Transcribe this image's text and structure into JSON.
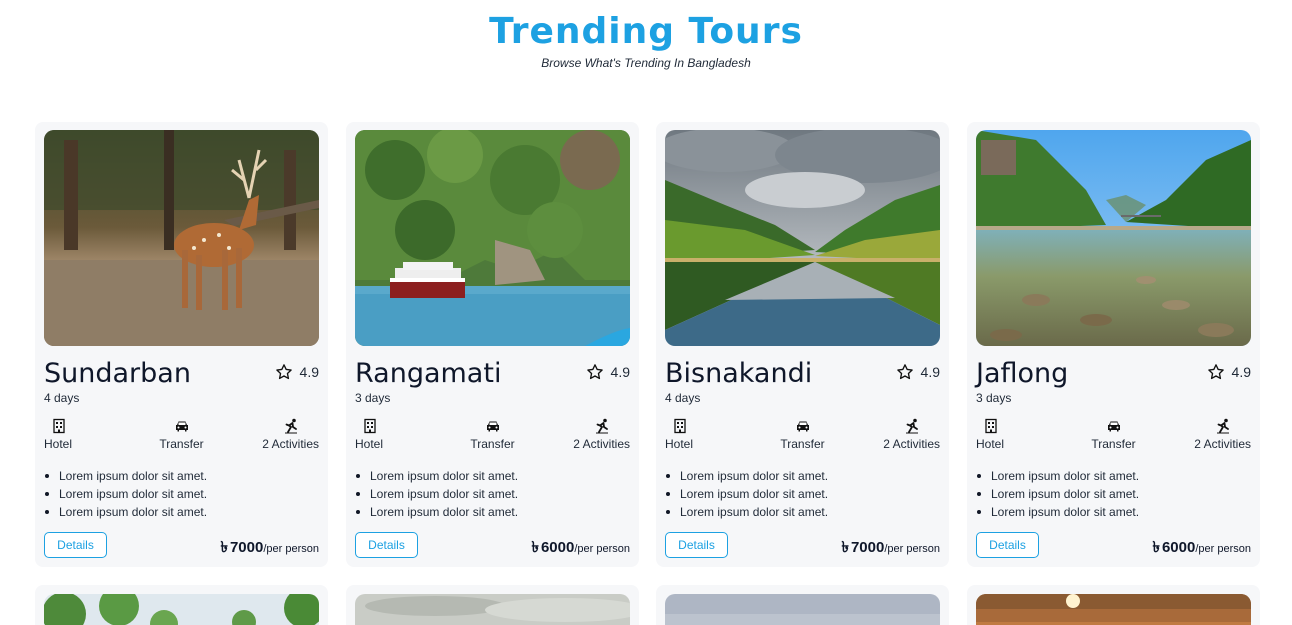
{
  "header": {
    "title": "Trending Tours",
    "subtitle": "Browse What's Trending In Bangladesh"
  },
  "tours": [
    {
      "name": "Sundarban",
      "rating": "4.9",
      "days": "4 days",
      "features": {
        "hotel": "Hotel",
        "transfer": "Transfer",
        "activities": "2 Activities"
      },
      "bullets": [
        "Lorem ipsum dolor sit amet.",
        "Lorem ipsum dolor sit amet.",
        "Lorem ipsum dolor sit amet."
      ],
      "details_label": "Details",
      "currency": "৳",
      "price": "7000",
      "per": "/per person",
      "image": "spotted-deer-forest"
    },
    {
      "name": "Rangamati",
      "rating": "4.9",
      "days": "3 days",
      "features": {
        "hotel": "Hotel",
        "transfer": "Transfer",
        "activities": "2 Activities"
      },
      "bullets": [
        "Lorem ipsum dolor sit amet.",
        "Lorem ipsum dolor sit amet.",
        "Lorem ipsum dolor sit amet."
      ],
      "details_label": "Details",
      "currency": "৳",
      "price": "6000",
      "per": "/per person",
      "image": "boat-lake-hills"
    },
    {
      "name": "Bisnakandi",
      "rating": "4.9",
      "days": "4 days",
      "features": {
        "hotel": "Hotel",
        "transfer": "Transfer",
        "activities": "2 Activities"
      },
      "bullets": [
        "Lorem ipsum dolor sit amet.",
        "Lorem ipsum dolor sit amet.",
        "Lorem ipsum dolor sit amet."
      ],
      "details_label": "Details",
      "currency": "৳",
      "price": "7000",
      "per": "/per person",
      "image": "mountain-reflection"
    },
    {
      "name": "Jaflong",
      "rating": "4.9",
      "days": "3 days",
      "features": {
        "hotel": "Hotel",
        "transfer": "Transfer",
        "activities": "2 Activities"
      },
      "bullets": [
        "Lorem ipsum dolor sit amet.",
        "Lorem ipsum dolor sit amet.",
        "Lorem ipsum dolor sit amet."
      ],
      "details_label": "Details",
      "currency": "৳",
      "price": "6000",
      "per": "/per person",
      "image": "clear-river-stones"
    }
  ],
  "colors": {
    "accent": "#1da1e2",
    "card_bg": "#f6f7f9"
  },
  "icons": [
    "star-icon",
    "hotel-icon",
    "car-icon",
    "activity-icon"
  ]
}
